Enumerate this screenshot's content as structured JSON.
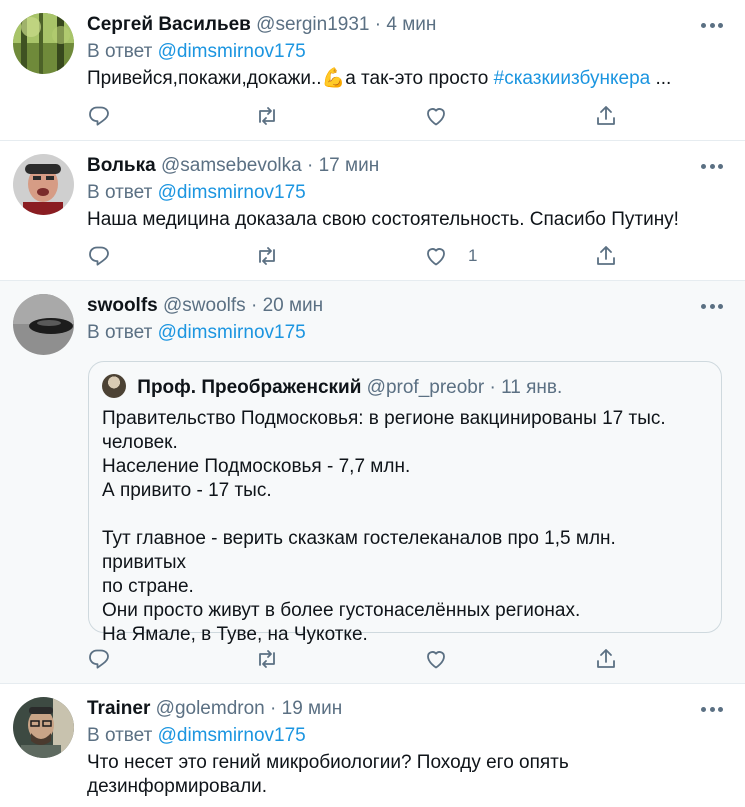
{
  "tweets": [
    {
      "name": "Сергей Васильев",
      "handle": "@sergin1931",
      "separator": "·",
      "time": "4 мин",
      "reply_prefix": "В ответ",
      "reply_to": "@dimsmirnov175",
      "text_main": "Привейся,покажи,докажи..💪а так-это просто ",
      "hashtag": "#сказкиизбункера",
      "text_tail": " ...",
      "likes": ""
    },
    {
      "name": "Волька",
      "handle": "@samsebevolka",
      "separator": "·",
      "time": "17 мин",
      "reply_prefix": "В ответ",
      "reply_to": "@dimsmirnov175",
      "text_main": "Наша медицина доказала свою состоятельность. Спасибо Путину!",
      "likes": "1"
    },
    {
      "name": "swoolfs",
      "handle": "@swoolfs",
      "separator": "·",
      "time": "20 мин",
      "reply_prefix": "В ответ",
      "reply_to": "@dimsmirnov175",
      "likes": "",
      "quote": {
        "name": "Проф. Преображенский",
        "handle": "@prof_preobr",
        "separator": "·",
        "time": "11 янв.",
        "lines": [
          "Правительство Подмосковья: в регионе вакцинированы 17 тыс.",
          "человек.",
          "Население Подмосковья - 7,7 млн.",
          "А привито - 17 тыс.",
          "",
          "Тут главное - верить сказкам гостелеканалов про 1,5 млн. привитых",
          "по стране.",
          "Они просто живут в более густонаселённых регионах.",
          "На Ямале, в Туве, на Чукотке."
        ]
      }
    },
    {
      "name": "Trainer",
      "handle": "@golemdron",
      "separator": "·",
      "time": "19 мин",
      "reply_prefix": "В ответ",
      "reply_to": "@dimsmirnov175",
      "text_line1": "Что несет это гений микробиологии? Походу его опять",
      "text_line2": "дезинформировали."
    }
  ],
  "icons": {
    "reply": "reply-icon",
    "retweet": "retweet-icon",
    "like": "like-icon",
    "share": "share-icon",
    "more": "more-icon"
  },
  "colors": {
    "link": "#1b95e0",
    "secondary": "#5b7083",
    "text": "#0f1419",
    "highlight_bg": "#f7f9fa",
    "border": "#e6ecf0"
  }
}
